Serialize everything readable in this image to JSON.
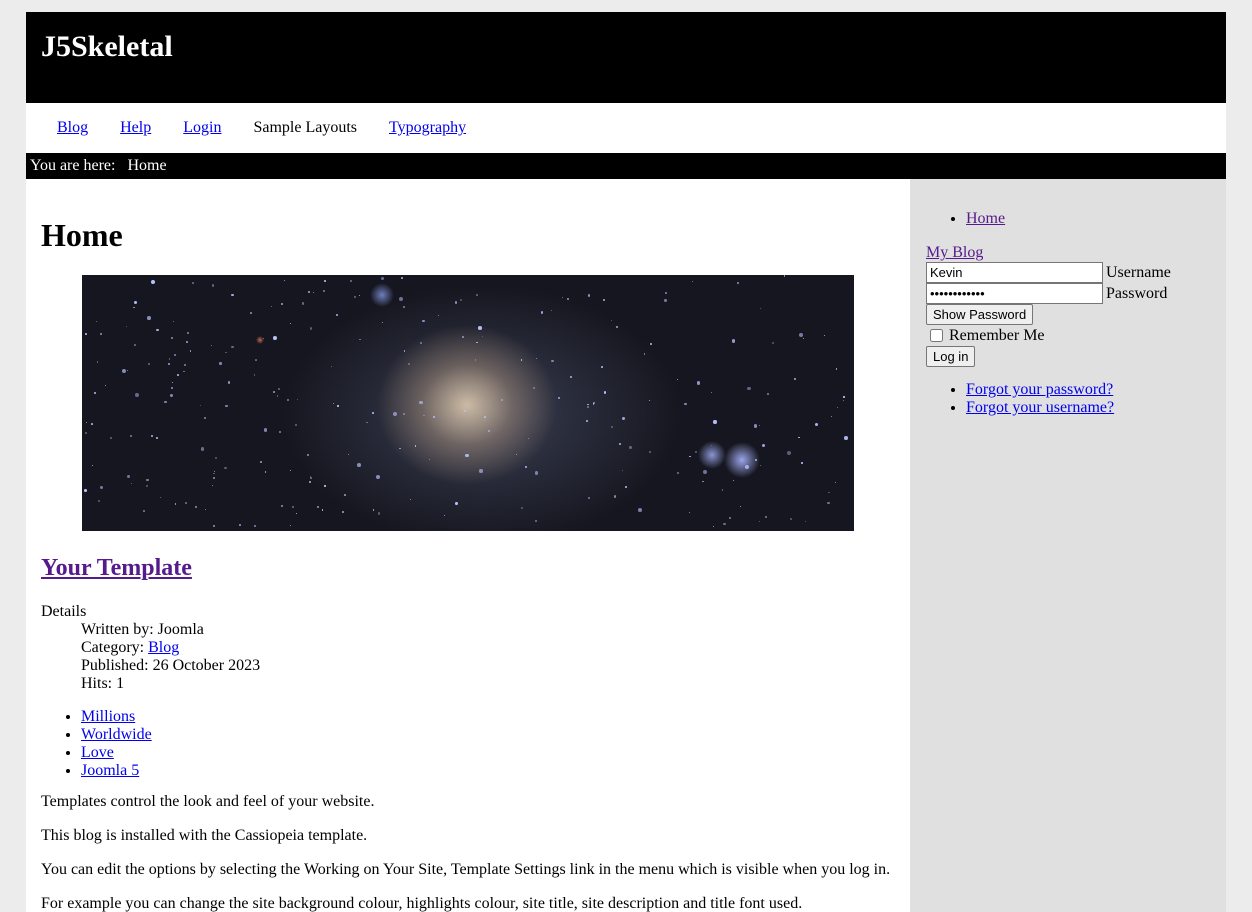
{
  "site": {
    "title": "J5Skeletal"
  },
  "nav": {
    "items": [
      {
        "label": "Blog",
        "link": true
      },
      {
        "label": "Help",
        "link": true
      },
      {
        "label": "Login",
        "link": true
      },
      {
        "label": "Sample Layouts",
        "link": false
      },
      {
        "label": "Typography",
        "link": true
      }
    ]
  },
  "breadcrumb": {
    "prefix": "You are here:",
    "current": "Home"
  },
  "main": {
    "page_title": "Home",
    "article": {
      "title": "Your Template",
      "details_label": "Details",
      "written_by": "Written by: Joomla",
      "category_label": "Category: ",
      "category_link": "Blog",
      "published": "Published: 26 October 2023",
      "hits": "Hits: 1"
    },
    "tags": [
      "Millions",
      "Worldwide",
      "Love",
      "Joomla 5"
    ],
    "paragraphs": [
      "Templates control the look and feel of your website.",
      "This blog is installed with the Cassiopeia template.",
      "You can edit the options by selecting the Working on Your Site, Template Settings link in the menu which is visible when you log in.",
      "For example you can change the site background colour, highlights colour, site title, site description and title font used."
    ]
  },
  "sidebar": {
    "menu": [
      "Home"
    ],
    "blog_link": "My Blog",
    "login": {
      "username_value": "Kevin",
      "username_label": "Username",
      "password_value": "••••••••••••",
      "password_label": "Password",
      "show_password": "Show Password",
      "remember_me": "Remember Me",
      "login_button": "Log in"
    },
    "links": [
      "Forgot your password?",
      "Forgot your username?"
    ]
  },
  "colors": {
    "page_bg": "#ececec",
    "header_bg": "#000000",
    "sidebar_bg": "#e0e0e0",
    "link": "#0000ee",
    "visited_link": "#551a8b"
  }
}
